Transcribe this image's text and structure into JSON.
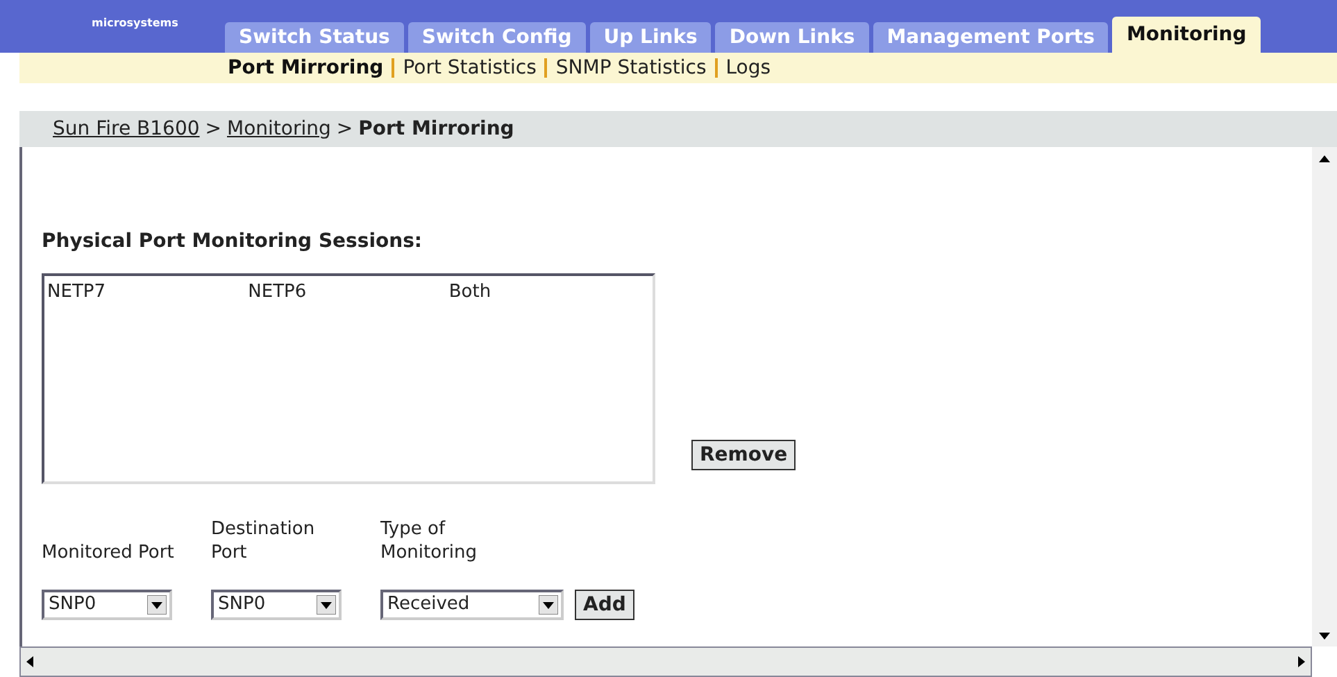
{
  "logo": {
    "text": "microsystems"
  },
  "tabs": [
    {
      "label": "Switch Status",
      "selected": false
    },
    {
      "label": "Switch Config",
      "selected": false
    },
    {
      "label": "Up Links",
      "selected": false
    },
    {
      "label": "Down Links",
      "selected": false
    },
    {
      "label": "Management Ports",
      "selected": false
    },
    {
      "label": "Monitoring",
      "selected": true
    }
  ],
  "subnav": [
    {
      "label": "Port Mirroring",
      "selected": true
    },
    {
      "label": "Port Statistics",
      "selected": false
    },
    {
      "label": "SNMP Statistics",
      "selected": false
    },
    {
      "label": "Logs",
      "selected": false
    }
  ],
  "breadcrumb": [
    {
      "label": "Sun Fire B1600",
      "kind": "link"
    },
    {
      "label": ">",
      "kind": "separator"
    },
    {
      "label": "Monitoring",
      "kind": "link"
    },
    {
      "label": ">",
      "kind": "separator"
    },
    {
      "label": "Port Mirroring",
      "kind": "current"
    }
  ],
  "section_title": "Physical Port Monitoring Sessions:",
  "sessions": [
    {
      "cells": [
        "NETP7",
        "NETP6",
        "Both"
      ]
    }
  ],
  "remove_button": "Remove",
  "fields": [
    {
      "label": "Monitored Port",
      "value": "SNP0"
    },
    {
      "label": "Destination Port",
      "value": "SNP0"
    },
    {
      "label": "Type of Monitoring",
      "value": "Received"
    }
  ],
  "add_button": "Add"
}
